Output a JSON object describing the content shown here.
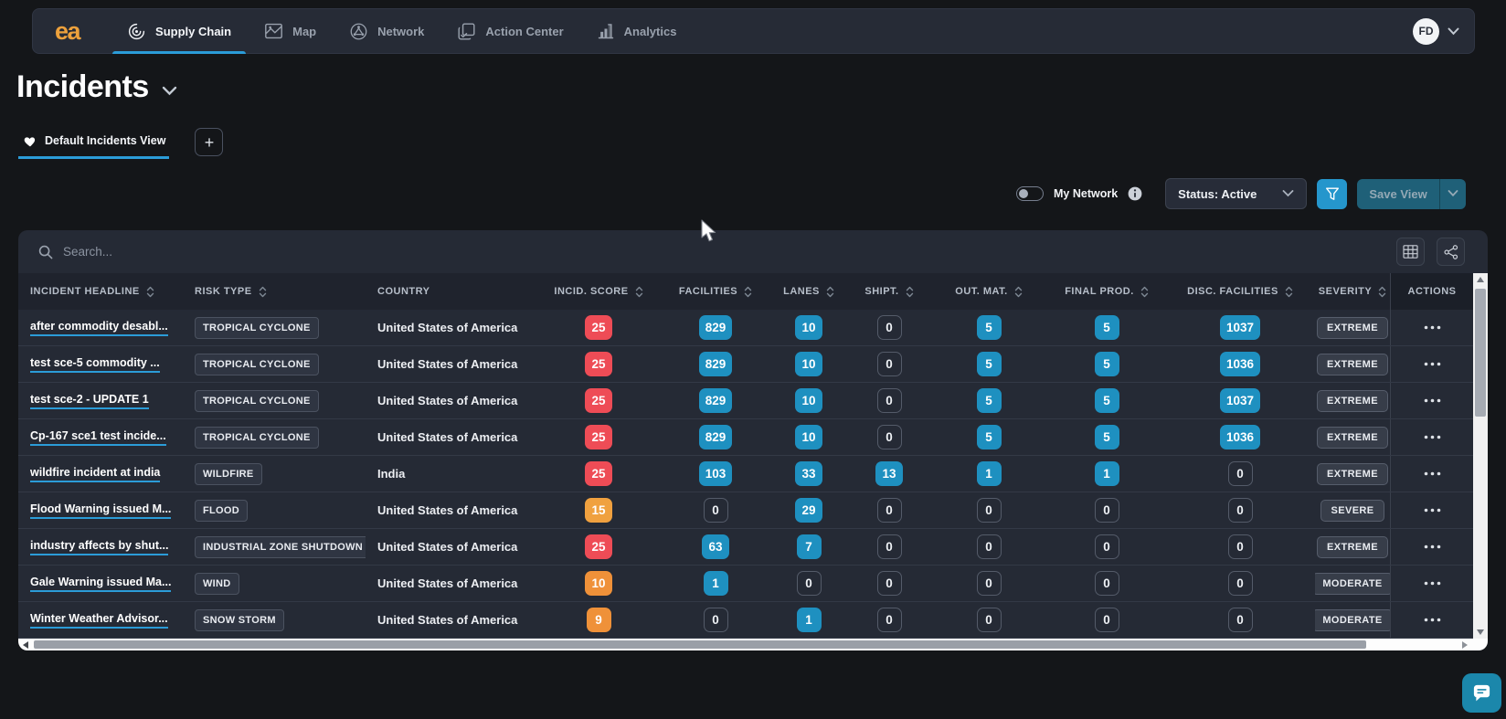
{
  "nav": {
    "logo_text": "ea",
    "tabs": [
      {
        "label": "Supply Chain",
        "icon": "supply-chain-icon",
        "active": true
      },
      {
        "label": "Map",
        "icon": "map-icon",
        "active": false
      },
      {
        "label": "Network",
        "icon": "network-icon",
        "active": false
      },
      {
        "label": "Action Center",
        "icon": "action-center-icon",
        "active": false
      },
      {
        "label": "Analytics",
        "icon": "analytics-icon",
        "active": false
      }
    ],
    "avatar_initials": "FD"
  },
  "page": {
    "title": "Incidents"
  },
  "views": {
    "active_view_label": "Default Incidents View",
    "add_view_label": "+"
  },
  "controls": {
    "my_network_label": "My Network",
    "my_network_on": false,
    "status_dropdown_value": "Status: Active",
    "save_view_label": "Save View"
  },
  "search": {
    "placeholder": "Search..."
  },
  "table": {
    "columns": [
      {
        "key": "headline",
        "label": "INCIDENT HEADLINE",
        "sortable": true,
        "align": "left"
      },
      {
        "key": "risk_type",
        "label": "RISK TYPE",
        "sortable": true,
        "align": "left"
      },
      {
        "key": "country",
        "label": "COUNTRY",
        "sortable": false,
        "align": "left"
      },
      {
        "key": "incid_score",
        "label": "INCID. SCORE",
        "sortable": true,
        "align": "center"
      },
      {
        "key": "facilities",
        "label": "FACILITIES",
        "sortable": true,
        "align": "center"
      },
      {
        "key": "lanes",
        "label": "LANES",
        "sortable": true,
        "align": "center"
      },
      {
        "key": "shipt",
        "label": "SHIPT.",
        "sortable": true,
        "align": "center"
      },
      {
        "key": "out_mat",
        "label": "OUT. MAT.",
        "sortable": true,
        "align": "center"
      },
      {
        "key": "final_prod",
        "label": "FINAL PROD.",
        "sortable": true,
        "align": "center"
      },
      {
        "key": "disc_facilities",
        "label": "DISC. FACILITIES",
        "sortable": true,
        "align": "center"
      },
      {
        "key": "severity",
        "label": "SEVERITY",
        "sortable": true,
        "align": "center"
      },
      {
        "key": "actions",
        "label": "ACTIONS",
        "sortable": false,
        "align": "center"
      }
    ],
    "rows": [
      {
        "headline": "after commodity desabl...",
        "risk_type": "TROPICAL CYCLONE",
        "country": "United States of America",
        "incid_score": 25,
        "score_color": "red",
        "facilities": 829,
        "lanes": 10,
        "shipt": 0,
        "out_mat": 5,
        "final_prod": 5,
        "disc_facilities": 1037,
        "severity": "EXTREME"
      },
      {
        "headline": "test sce-5 commodity ...",
        "risk_type": "TROPICAL CYCLONE",
        "country": "United States of America",
        "incid_score": 25,
        "score_color": "red",
        "facilities": 829,
        "lanes": 10,
        "shipt": 0,
        "out_mat": 5,
        "final_prod": 5,
        "disc_facilities": 1036,
        "severity": "EXTREME"
      },
      {
        "headline": "test sce-2 - UPDATE 1",
        "risk_type": "TROPICAL CYCLONE",
        "country": "United States of America",
        "incid_score": 25,
        "score_color": "red",
        "facilities": 829,
        "lanes": 10,
        "shipt": 0,
        "out_mat": 5,
        "final_prod": 5,
        "disc_facilities": 1037,
        "severity": "EXTREME"
      },
      {
        "headline": "Cp-167 sce1 test incide...",
        "risk_type": "TROPICAL CYCLONE",
        "country": "United States of America",
        "incid_score": 25,
        "score_color": "red",
        "facilities": 829,
        "lanes": 10,
        "shipt": 0,
        "out_mat": 5,
        "final_prod": 5,
        "disc_facilities": 1036,
        "severity": "EXTREME"
      },
      {
        "headline": "wildfire incident at india",
        "risk_type": "WILDFIRE",
        "country": "India",
        "incid_score": 25,
        "score_color": "red",
        "facilities": 103,
        "lanes": 33,
        "shipt": 13,
        "out_mat": 1,
        "final_prod": 1,
        "disc_facilities": 0,
        "severity": "EXTREME"
      },
      {
        "headline": "Flood Warning issued M...",
        "risk_type": "FLOOD",
        "country": "United States of America",
        "incid_score": 15,
        "score_color": "amber",
        "facilities": 0,
        "lanes": 29,
        "shipt": 0,
        "out_mat": 0,
        "final_prod": 0,
        "disc_facilities": 0,
        "severity": "SEVERE"
      },
      {
        "headline": "industry affects by shut...",
        "risk_type": "INDUSTRIAL ZONE SHUTDOWN",
        "country": "United States of America",
        "incid_score": 25,
        "score_color": "red",
        "facilities": 63,
        "lanes": 7,
        "shipt": 0,
        "out_mat": 0,
        "final_prod": 0,
        "disc_facilities": 0,
        "severity": "EXTREME"
      },
      {
        "headline": "Gale Warning issued Ma...",
        "risk_type": "WIND",
        "country": "United States of America",
        "incid_score": 10,
        "score_color": "orange",
        "facilities": 1,
        "lanes": 0,
        "shipt": 0,
        "out_mat": 0,
        "final_prod": 0,
        "disc_facilities": 0,
        "severity": "MODERATE"
      },
      {
        "headline": "Winter Weather Advisor...",
        "risk_type": "SNOW STORM",
        "country": "United States of America",
        "incid_score": 9,
        "score_color": "orange",
        "facilities": 0,
        "lanes": 1,
        "shipt": 0,
        "out_mat": 0,
        "final_prod": 0,
        "disc_facilities": 0,
        "severity": "MODERATE"
      }
    ]
  },
  "colors": {
    "accent_blue": "#2b9cd8",
    "badge_blue": "#1e90c0",
    "score_red": "#ee4c56",
    "score_orange": "#ef9139",
    "score_amber": "#f0a13f",
    "filter_button": "#2596cc",
    "chat_button": "#1b87ab"
  }
}
